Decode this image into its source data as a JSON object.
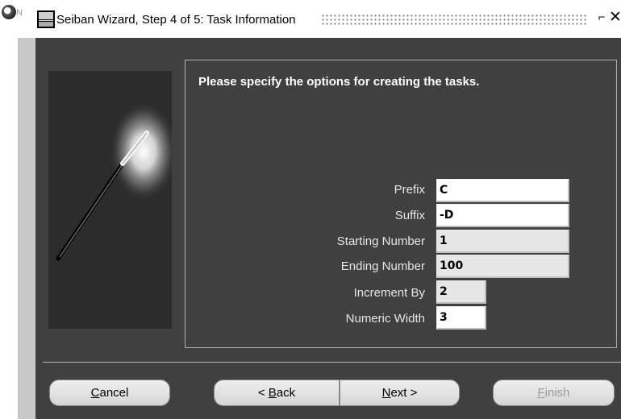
{
  "window": {
    "title": "Seiban Wizard, Step 4 of 5: Task Information",
    "app_icon_tail": "N",
    "minimize_glyph": "⌐",
    "close_glyph": "✕"
  },
  "instructions": "Please specify the options for creating the tasks.",
  "fields": [
    {
      "label": "Prefix",
      "value": "C",
      "editable": true
    },
    {
      "label": "Suffix",
      "value": "-D",
      "editable": true
    },
    {
      "label": "Starting Number",
      "value": "1",
      "editable": false
    },
    {
      "label": "Ending Number",
      "value": "100",
      "editable": false
    },
    {
      "label": "Increment By",
      "value": "2",
      "editable": false
    },
    {
      "label": "Numeric Width",
      "value": "3",
      "editable": true
    }
  ],
  "buttons": {
    "cancel": {
      "label": "Cancel",
      "mnemonic": "C",
      "rest": "ancel"
    },
    "back": {
      "label": "< Back",
      "prefix": "< ",
      "mnemonic": "B",
      "rest": "ack"
    },
    "next": {
      "label": "Next >",
      "mnemonic": "N",
      "rest": "ext >"
    },
    "finish": {
      "label": "Finish",
      "mnemonic": "F",
      "rest": "inish",
      "enabled": false
    }
  },
  "colors": {
    "dialog_bg": "#404040",
    "panel_border": "#b0b0b0",
    "button_bg": "#e6e6e6"
  }
}
